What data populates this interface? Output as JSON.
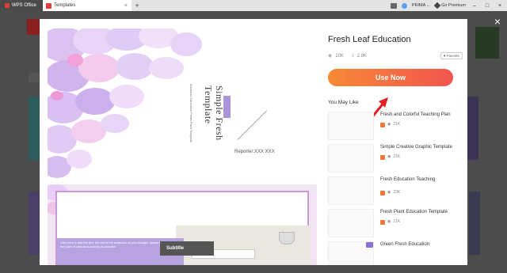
{
  "titlebar": {
    "app_tab": "WPS Office",
    "doc_tab": "Templates",
    "user_name": "PRIMA ...",
    "go_premium": "Go Premium"
  },
  "template": {
    "name": "Fresh Leaf Education",
    "views": "10K",
    "downloads": "2.8K",
    "favorite_label": "Favorite",
    "use_now": "Use Now",
    "you_may_like": "You May Like"
  },
  "slide": {
    "title": "Simple Fresh Template",
    "subtitle_lines": "Business Education PowerPoint Template",
    "reporter": "Reporter:XXX XXX",
    "subtitle_box": "Subtitle",
    "body_text": "Click here to add the text, the text is the extraction of your thought, please try to explain the point of view as succinctly as possible."
  },
  "recommendations": [
    {
      "title": "Fresh and Colorful Teaching Plan",
      "views": "21K"
    },
    {
      "title": "Simple Creative Graphic Template",
      "views": "21K"
    },
    {
      "title": "Fresh Education Teaching",
      "views": "23K"
    },
    {
      "title": "Fresh Plant Education Template",
      "views": "21K"
    },
    {
      "title": "Green Fresh Education",
      "views": ""
    }
  ],
  "colors": {
    "use_now_start": "#f78a36",
    "use_now_end": "#f2544f",
    "accent_purple": "#a896d8",
    "arrow_red": "#e32020"
  }
}
